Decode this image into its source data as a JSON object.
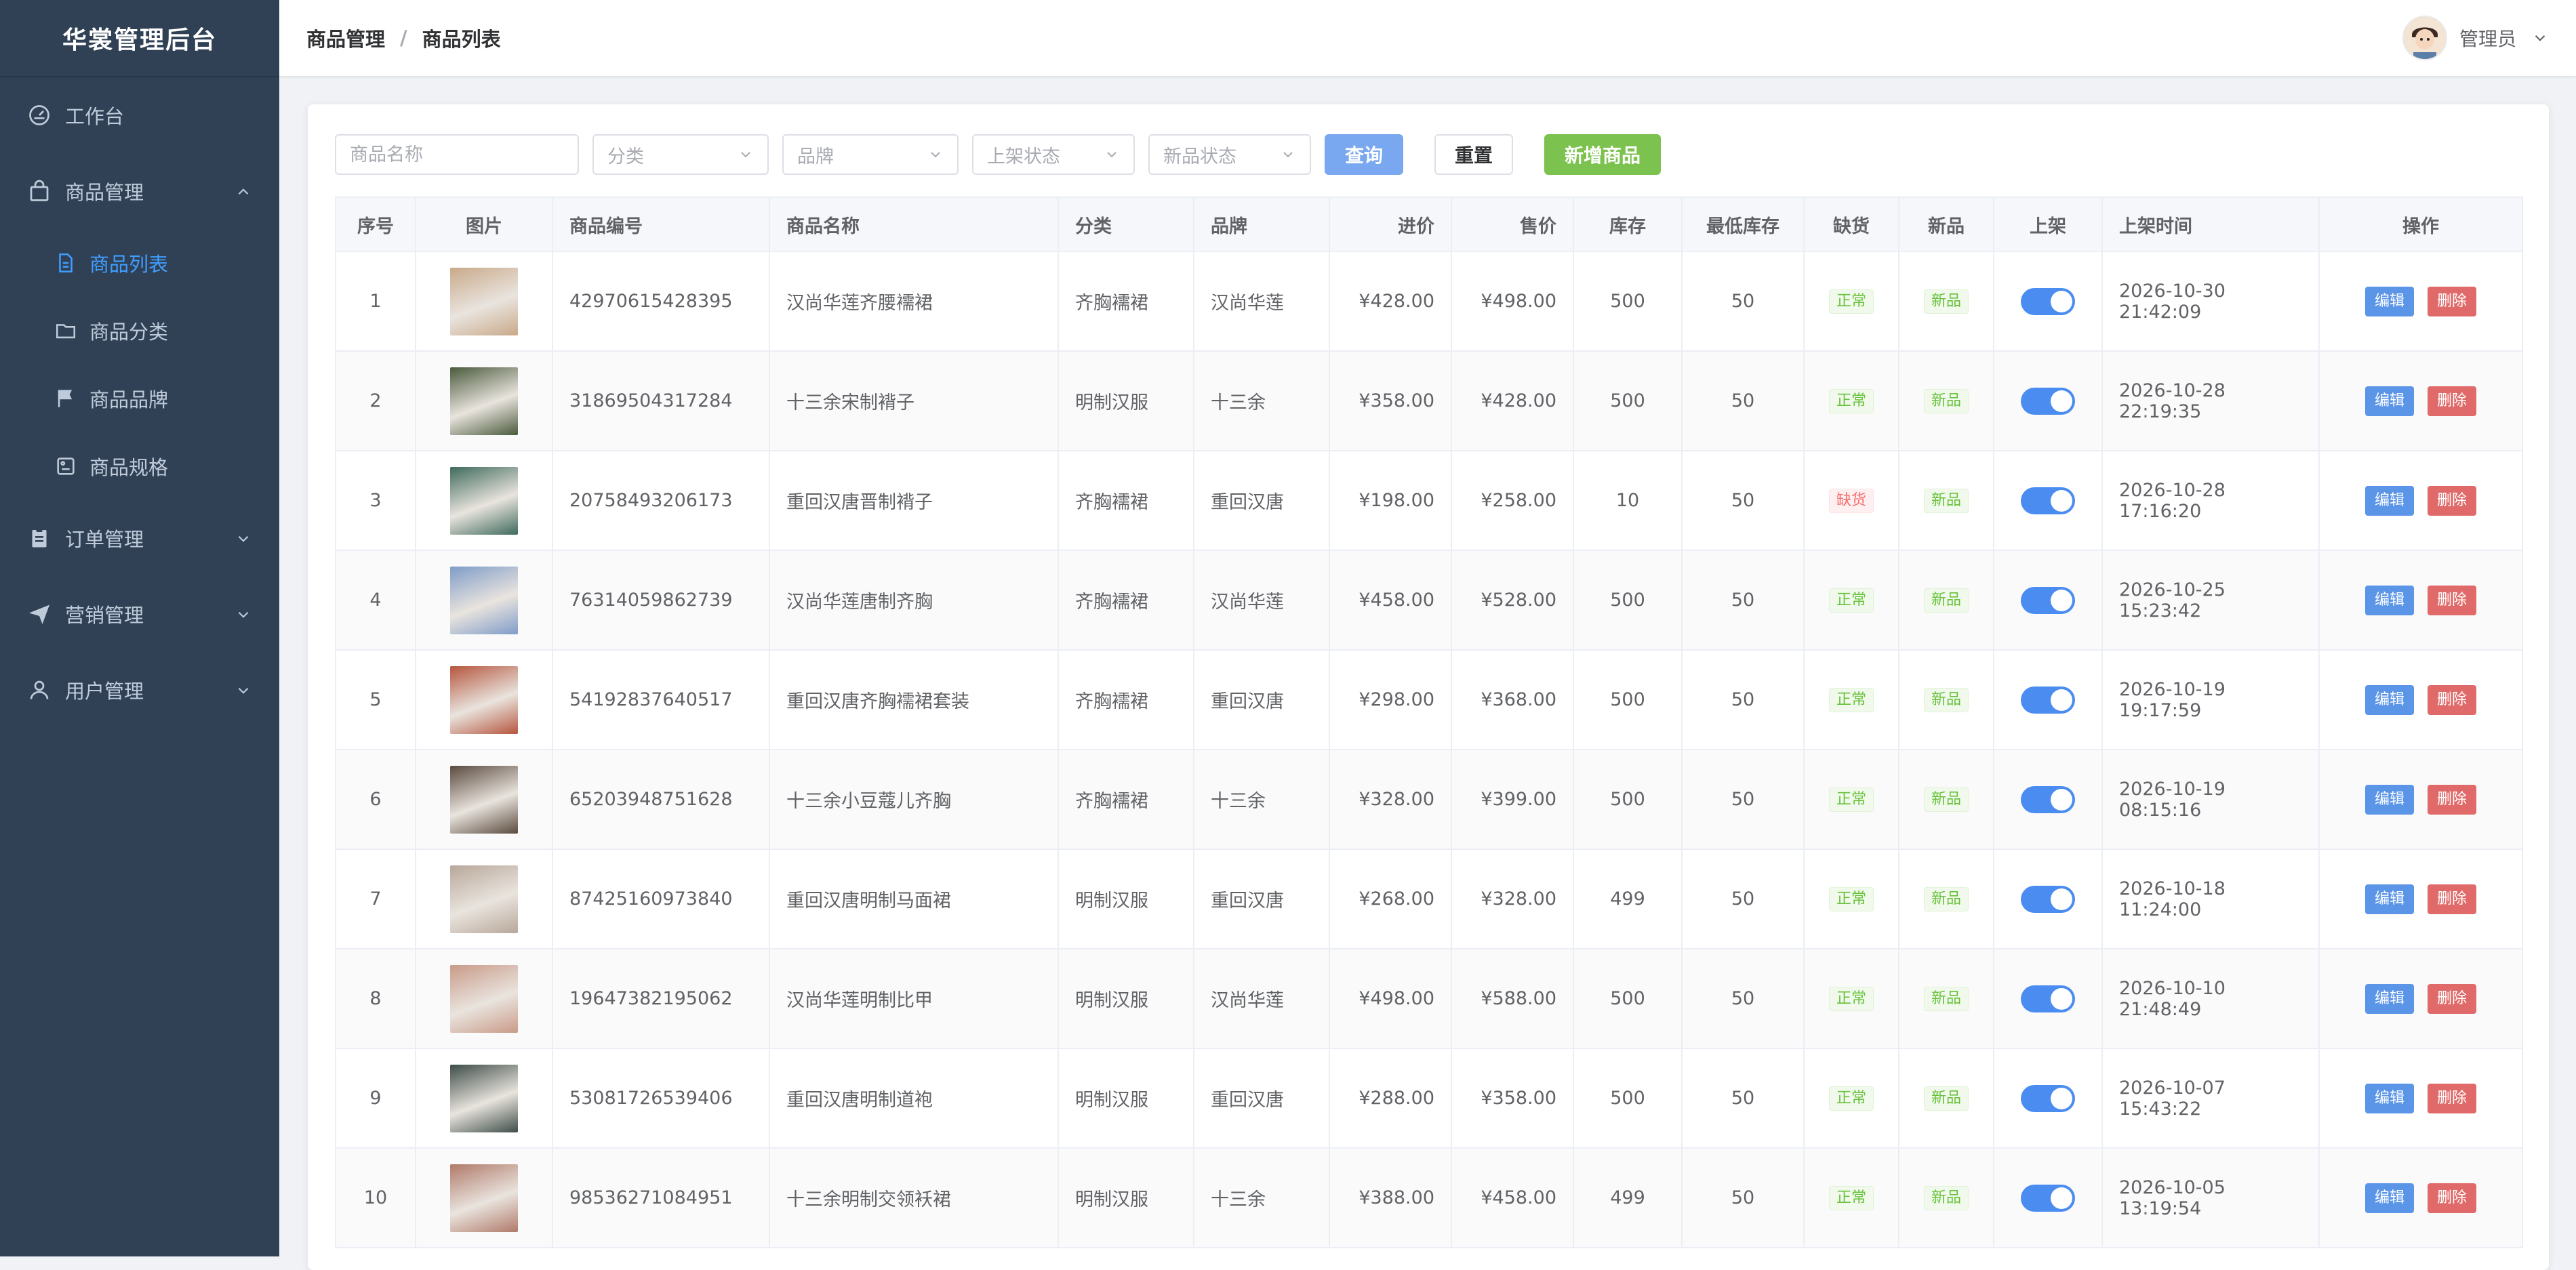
{
  "app": {
    "title": "华裳管理后台"
  },
  "sidebar": {
    "items": [
      {
        "label": "工作台",
        "icon": "dashboard-icon"
      },
      {
        "label": "商品管理",
        "icon": "bag-icon",
        "expanded": true,
        "children": [
          {
            "label": "商品列表",
            "icon": "document-icon",
            "active": true
          },
          {
            "label": "商品分类",
            "icon": "folder-icon"
          },
          {
            "label": "商品品牌",
            "icon": "flag-icon"
          },
          {
            "label": "商品规格",
            "icon": "tag-icon"
          }
        ]
      },
      {
        "label": "订单管理",
        "icon": "clipboard-icon"
      },
      {
        "label": "营销管理",
        "icon": "paper-plane-icon"
      },
      {
        "label": "用户管理",
        "icon": "user-icon"
      }
    ]
  },
  "header": {
    "breadcrumb": [
      "商品管理",
      "商品列表"
    ],
    "breadcrumb_separator": "/",
    "user": {
      "name": "管理员",
      "icon": "avatar"
    }
  },
  "filters": {
    "name_placeholder": "商品名称",
    "category_placeholder": "分类",
    "brand_placeholder": "品牌",
    "shelf_status_placeholder": "上架状态",
    "new_status_placeholder": "新品状态",
    "search_label": "查询",
    "reset_label": "重置",
    "add_label": "新增商品"
  },
  "table": {
    "columns": [
      "序号",
      "图片",
      "商品编号",
      "商品名称",
      "分类",
      "品牌",
      "进价",
      "售价",
      "库存",
      "最低库存",
      "缺货",
      "新品",
      "上架",
      "上架时间",
      "操作"
    ],
    "edit_label": "编辑",
    "delete_label": "删除",
    "rows": [
      {
        "index": "1",
        "code": "42970615428395",
        "name": "汉尚华莲齐腰襦裙",
        "category": "齐胸襦裙",
        "brand": "汉尚华莲",
        "cost": "¥428.00",
        "price": "¥498.00",
        "stock": "500",
        "min_stock": "50",
        "shortage": "正常",
        "is_new": "新品",
        "on_shelf": true,
        "time": "2026-10-30 21:42:09",
        "thumb_color": "#c9a98a"
      },
      {
        "index": "2",
        "code": "31869504317284",
        "name": "十三余宋制褙子",
        "category": "明制汉服",
        "brand": "十三余",
        "cost": "¥358.00",
        "price": "¥428.00",
        "stock": "500",
        "min_stock": "50",
        "shortage": "正常",
        "is_new": "新品",
        "on_shelf": true,
        "time": "2026-10-28 22:19:35",
        "thumb_color": "#4a5a3c"
      },
      {
        "index": "3",
        "code": "20758493206173",
        "name": "重回汉唐晋制褙子",
        "category": "齐胸襦裙",
        "brand": "重回汉唐",
        "cost": "¥198.00",
        "price": "¥258.00",
        "stock": "10",
        "min_stock": "50",
        "shortage": "缺货",
        "is_new": "新品",
        "on_shelf": true,
        "time": "2026-10-28 17:16:20",
        "thumb_color": "#3f6a5c"
      },
      {
        "index": "4",
        "code": "76314059862739",
        "name": "汉尚华莲唐制齐胸",
        "category": "齐胸襦裙",
        "brand": "汉尚华莲",
        "cost": "¥458.00",
        "price": "¥528.00",
        "stock": "500",
        "min_stock": "50",
        "shortage": "正常",
        "is_new": "新品",
        "on_shelf": true,
        "time": "2026-10-25 15:23:42",
        "thumb_color": "#7f9cc8"
      },
      {
        "index": "5",
        "code": "54192837640517",
        "name": "重回汉唐齐胸襦裙套装",
        "category": "齐胸襦裙",
        "brand": "重回汉唐",
        "cost": "¥298.00",
        "price": "¥368.00",
        "stock": "500",
        "min_stock": "50",
        "shortage": "正常",
        "is_new": "新品",
        "on_shelf": true,
        "time": "2026-10-19 19:17:59",
        "thumb_color": "#b5563e"
      },
      {
        "index": "6",
        "code": "65203948751628",
        "name": "十三余小豆蔻儿齐胸",
        "category": "齐胸襦裙",
        "brand": "十三余",
        "cost": "¥328.00",
        "price": "¥399.00",
        "stock": "500",
        "min_stock": "50",
        "shortage": "正常",
        "is_new": "新品",
        "on_shelf": true,
        "time": "2026-10-19 08:15:16",
        "thumb_color": "#5a4a3e"
      },
      {
        "index": "7",
        "code": "87425160973840",
        "name": "重回汉唐明制马面裙",
        "category": "明制汉服",
        "brand": "重回汉唐",
        "cost": "¥268.00",
        "price": "¥328.00",
        "stock": "499",
        "min_stock": "50",
        "shortage": "正常",
        "is_new": "新品",
        "on_shelf": true,
        "time": "2026-10-18 11:24:00",
        "thumb_color": "#b8a79a"
      },
      {
        "index": "8",
        "code": "19647382195062",
        "name": "汉尚华莲明制比甲",
        "category": "明制汉服",
        "brand": "汉尚华莲",
        "cost": "¥498.00",
        "price": "¥588.00",
        "stock": "500",
        "min_stock": "50",
        "shortage": "正常",
        "is_new": "新品",
        "on_shelf": true,
        "time": "2026-10-10 21:48:49",
        "thumb_color": "#c99a88"
      },
      {
        "index": "9",
        "code": "53081726539406",
        "name": "重回汉唐明制道袍",
        "category": "明制汉服",
        "brand": "重回汉唐",
        "cost": "¥288.00",
        "price": "¥358.00",
        "stock": "500",
        "min_stock": "50",
        "shortage": "正常",
        "is_new": "新品",
        "on_shelf": true,
        "time": "2026-10-07 15:43:22",
        "thumb_color": "#3e4d48"
      },
      {
        "index": "10",
        "code": "98536271084951",
        "name": "十三余明制交领袄裙",
        "category": "明制汉服",
        "brand": "十三余",
        "cost": "¥388.00",
        "price": "¥458.00",
        "stock": "499",
        "min_stock": "50",
        "shortage": "正常",
        "is_new": "新品",
        "on_shelf": true,
        "time": "2026-10-05 13:19:54",
        "thumb_color": "#b07a6a"
      }
    ]
  },
  "colors": {
    "sidebar_bg": "#304156",
    "accent": "#409eff",
    "success": "#67c23a",
    "danger": "#f56c6c"
  }
}
